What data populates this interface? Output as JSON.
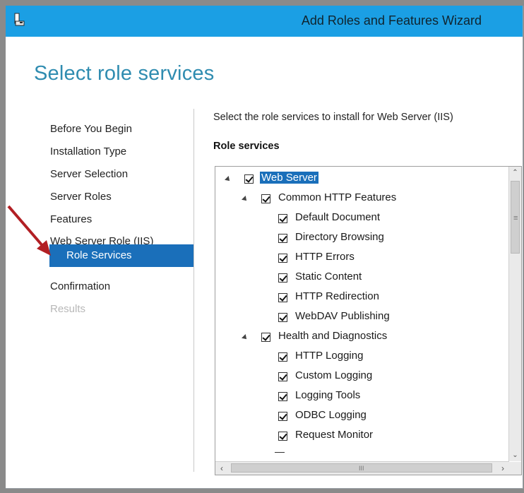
{
  "window": {
    "title": "Add Roles and Features Wizard",
    "app_icon": "server-manager-icon"
  },
  "page_title": "Select role services",
  "nav": {
    "items": [
      {
        "label": "Before You Begin",
        "state": "normal"
      },
      {
        "label": "Installation Type",
        "state": "normal"
      },
      {
        "label": "Server Selection",
        "state": "normal"
      },
      {
        "label": "Server Roles",
        "state": "normal"
      },
      {
        "label": "Features",
        "state": "normal"
      },
      {
        "label": "Web Server Role (IIS)",
        "state": "normal"
      },
      {
        "label": "Role Services",
        "state": "selected"
      },
      {
        "label": "Confirmation",
        "state": "normal"
      },
      {
        "label": "Results",
        "state": "disabled"
      }
    ]
  },
  "content": {
    "instruction": "Select the role services to install for Web Server (IIS)",
    "section_label": "Role services",
    "tree": [
      {
        "label": "Web Server",
        "level": 0,
        "checked": true,
        "expanded": true,
        "selected": true
      },
      {
        "label": "Common HTTP Features",
        "level": 1,
        "checked": true,
        "expanded": true
      },
      {
        "label": "Default Document",
        "level": 2,
        "checked": true
      },
      {
        "label": "Directory Browsing",
        "level": 2,
        "checked": true
      },
      {
        "label": "HTTP Errors",
        "level": 2,
        "checked": true
      },
      {
        "label": "Static Content",
        "level": 2,
        "checked": true
      },
      {
        "label": "HTTP Redirection",
        "level": 2,
        "checked": true
      },
      {
        "label": "WebDAV Publishing",
        "level": 2,
        "checked": true
      },
      {
        "label": "Health and Diagnostics",
        "level": 1,
        "checked": true,
        "expanded": true
      },
      {
        "label": "HTTP Logging",
        "level": 2,
        "checked": true
      },
      {
        "label": "Custom Logging",
        "level": 2,
        "checked": true
      },
      {
        "label": "Logging Tools",
        "level": 2,
        "checked": true
      },
      {
        "label": "ODBC Logging",
        "level": 2,
        "checked": true
      },
      {
        "label": "Request Monitor",
        "level": 2,
        "checked": true
      }
    ]
  },
  "colors": {
    "titlebar": "#1b9fe4",
    "accent": "#1a6fba",
    "title_text": "#2f8cb0",
    "arrow": "#b21f24"
  }
}
